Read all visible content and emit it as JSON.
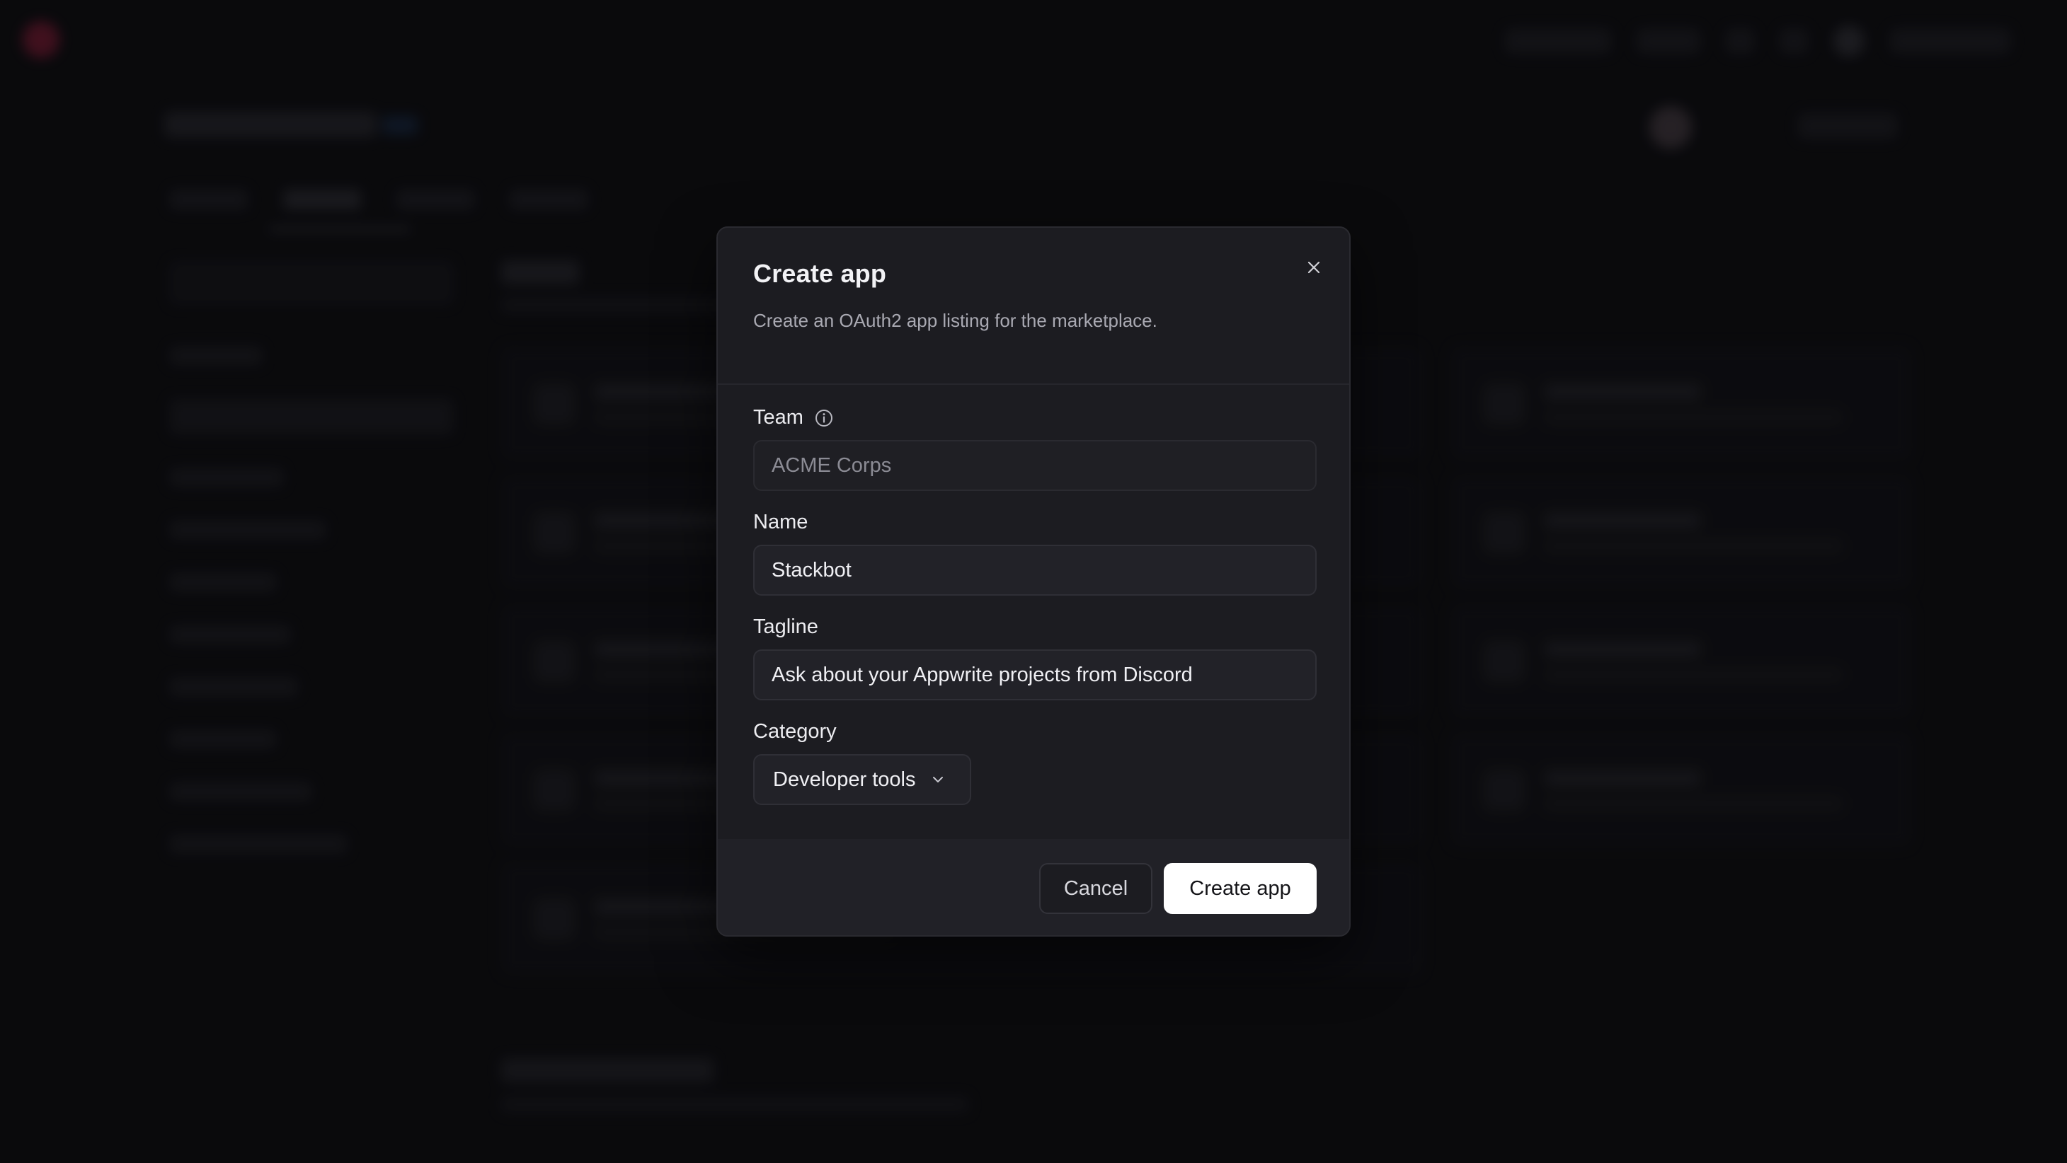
{
  "modal": {
    "title": "Create app",
    "description": "Create an OAuth2 app listing for the marketplace.",
    "close_icon": "close-icon"
  },
  "form": {
    "team": {
      "label": "Team",
      "info_icon": "info-icon",
      "value": "ACME Corps"
    },
    "name": {
      "label": "Name",
      "value": "Stackbot"
    },
    "tagline": {
      "label": "Tagline",
      "value": "Ask about your Appwrite projects from Discord"
    },
    "category": {
      "label": "Category",
      "value": "Developer tools",
      "icon": "chevron-down-icon"
    }
  },
  "footer": {
    "cancel_label": "Cancel",
    "create_label": "Create app"
  },
  "colors": {
    "background": "#0d0d10",
    "modal": "#1c1c21",
    "primary_button": "#ffffff",
    "brand": "#c0234a"
  }
}
